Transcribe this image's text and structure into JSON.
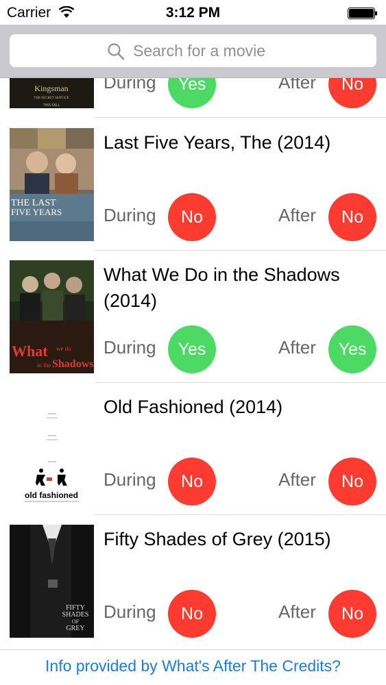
{
  "status_bar": {
    "carrier": "Carrier",
    "time": "3:12 PM"
  },
  "search": {
    "placeholder": "Search for a movie"
  },
  "colors": {
    "yes": "#4cd964",
    "no": "#fe3b30",
    "link": "#1a7cdf",
    "search_bar_bg": "#c9c9cf"
  },
  "movies": [
    {
      "title": "",
      "poster_text": [
        "Kingsman",
        "THE SECRET SERVICE",
        "THIS FALL"
      ],
      "during_label": "During",
      "during": "Yes",
      "after_label": "After",
      "after": "No"
    },
    {
      "title": "Last Five Years, The (2014)",
      "poster_text": [
        "THE LAST",
        "FIVE YEARS"
      ],
      "during_label": "During",
      "during": "No",
      "after_label": "After",
      "after": "No"
    },
    {
      "title": "What We Do in the Shadows (2014)",
      "poster_text": [
        "What",
        "we do",
        "in the",
        "Shadows"
      ],
      "during_label": "During",
      "during": "Yes",
      "after_label": "After",
      "after": "Yes"
    },
    {
      "title": "Old Fashioned (2014)",
      "poster_text": [
        "old fashioned"
      ],
      "during_label": "During",
      "during": "No",
      "after_label": "After",
      "after": "No"
    },
    {
      "title": "Fifty Shades of Grey (2015)",
      "poster_text": [
        "FIFTY",
        "SHADES",
        "OF",
        "GREY"
      ],
      "during_label": "During",
      "during": "No",
      "after_label": "After",
      "after": "No"
    }
  ],
  "footer": {
    "link_text": "Info provided by What's After The Credits?"
  }
}
